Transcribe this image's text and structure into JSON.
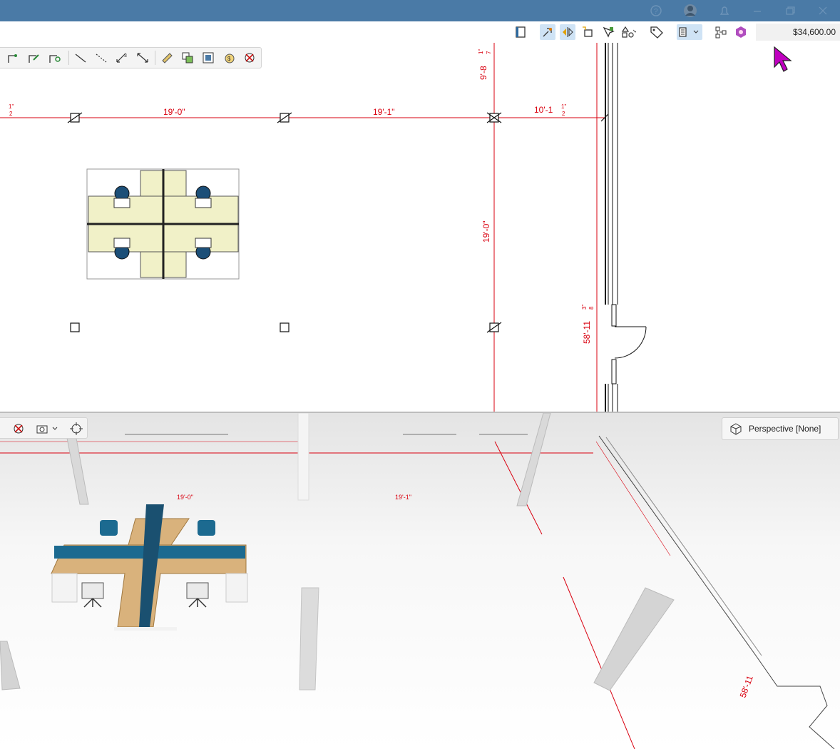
{
  "toolbar": {
    "total_price": "$34,600.00"
  },
  "plan": {
    "dimensions": [
      "19'-0\"",
      "19'-1\"",
      "10'-1",
      "19'-0\"",
      "58'-11",
      "9'-8"
    ],
    "fractions": [
      "1\"",
      "2",
      "1\"",
      "2",
      "1\"",
      "7",
      "3\"",
      "8"
    ]
  },
  "view3d": {
    "view_mode_label": "Perspective [None]",
    "dimensions": [
      "19'-0\"",
      "19'-1\"",
      "58'-11"
    ]
  },
  "colors": {
    "titlebar": "#4a7aa6",
    "dimension": "#d9000f",
    "cursor": "#c000c0",
    "cushion": "#1c6a90",
    "worktop": "#d9b27c"
  },
  "icons": [
    "help-icon",
    "user-avatar-icon",
    "notification-icon",
    "minimize-icon",
    "restore-icon",
    "close-icon",
    "book-icon",
    "snap-icon",
    "mirror-icon",
    "box-select-icon",
    "select-filter-icon",
    "shapes-icon",
    "tag-icon",
    "list-view-icon",
    "network-icon",
    "render-icon",
    "camera-icon",
    "focus-icon",
    "cube-icon"
  ]
}
